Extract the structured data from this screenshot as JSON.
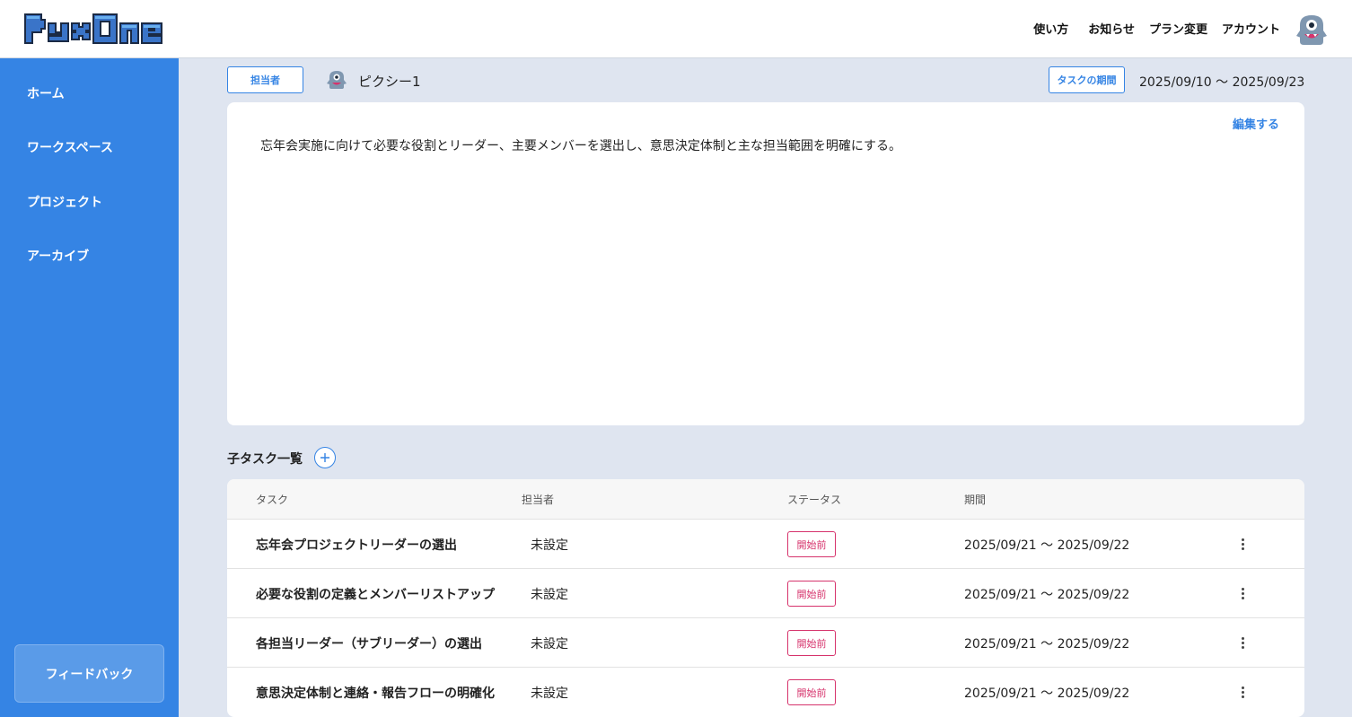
{
  "header": {
    "logo_text": "PyxOne",
    "nav": [
      "使い方",
      "お知らせ",
      "プラン変更",
      "アカウント"
    ]
  },
  "sidebar": {
    "items": [
      {
        "label": "ホーム"
      },
      {
        "label": "ワークスペース"
      },
      {
        "label": "プロジェクト"
      },
      {
        "label": "アーカイブ"
      }
    ],
    "feedback_label": "フィードバック"
  },
  "task": {
    "assignee_label": "担当者",
    "assignee_name": "ピクシー1",
    "period_label": "タスクの期間",
    "period_value": "2025/09/10 〜 2025/09/23",
    "edit_label": "編集する",
    "description": "忘年会実施に向けて必要な役割とリーダー、主要メンバーを選出し、意思決定体制と主な担当範囲を明確にする。"
  },
  "subtasks": {
    "title": "子タスク一覧",
    "add_icon": "plus-icon",
    "columns": [
      "タスク",
      "担当者",
      "ステータス",
      "期間"
    ],
    "rows": [
      {
        "task": "忘年会プロジェクトリーダーの選出",
        "assignee": "未設定",
        "status": "開始前",
        "period": "2025/09/21 〜 2025/09/22"
      },
      {
        "task": "必要な役割の定義とメンバーリストアップ",
        "assignee": "未設定",
        "status": "開始前",
        "period": "2025/09/21 〜 2025/09/22"
      },
      {
        "task": "各担当リーダー（サブリーダー）の選出",
        "assignee": "未設定",
        "status": "開始前",
        "period": "2025/09/21 〜 2025/09/22"
      },
      {
        "task": "意思決定体制と連絡・報告フローの明確化",
        "assignee": "未設定",
        "status": "開始前",
        "period": "2025/09/21 〜 2025/09/22"
      }
    ]
  },
  "colors": {
    "accent": "#3584e4",
    "status_not_started": "#d6336c",
    "background": "#dfe5f0"
  }
}
